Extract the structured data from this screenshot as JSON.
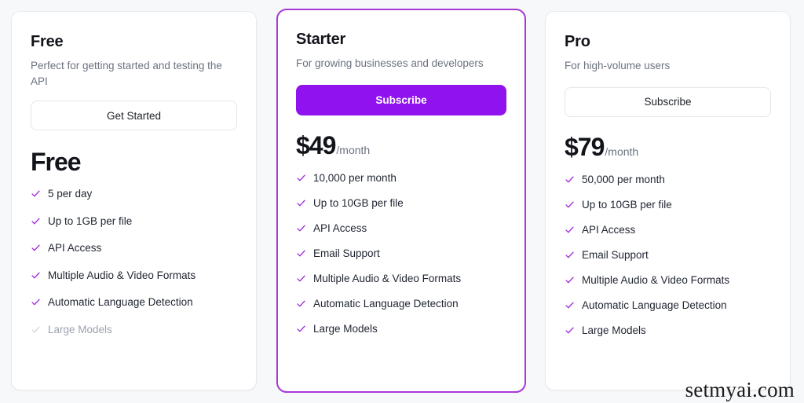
{
  "theme": {
    "page_background": "#f7f8fa",
    "accent": "#9013ef",
    "featured_border": "#a738d8",
    "check_color": "#a32fd8",
    "check_color_disabled": "#d2d6dc",
    "text_primary": "#12141a",
    "text_muted": "#6b7280"
  },
  "watermark": "setmyai.com",
  "plans": [
    {
      "id": "free",
      "name": "Free",
      "description": "Perfect for getting started and testing the API",
      "cta_label": "Get Started",
      "cta_style": "outline",
      "price_amount": "Free",
      "price_period": "",
      "featured": false,
      "features": [
        {
          "label": "5 per day",
          "enabled": true
        },
        {
          "label": "Up to 1GB per file",
          "enabled": true
        },
        {
          "label": "API Access",
          "enabled": true
        },
        {
          "label": "Multiple Audio & Video Formats",
          "enabled": true
        },
        {
          "label": "Automatic Language Detection",
          "enabled": true
        },
        {
          "label": "Large Models",
          "enabled": false
        }
      ]
    },
    {
      "id": "starter",
      "name": "Starter",
      "description": "For growing businesses and developers",
      "cta_label": "Subscribe",
      "cta_style": "filled",
      "price_amount": "$49",
      "price_period": "/month",
      "featured": true,
      "features": [
        {
          "label": "10,000 per month",
          "enabled": true
        },
        {
          "label": "Up to 10GB per file",
          "enabled": true
        },
        {
          "label": "API Access",
          "enabled": true
        },
        {
          "label": "Email Support",
          "enabled": true
        },
        {
          "label": "Multiple Audio & Video Formats",
          "enabled": true
        },
        {
          "label": "Automatic Language Detection",
          "enabled": true
        },
        {
          "label": "Large Models",
          "enabled": true
        }
      ]
    },
    {
      "id": "pro",
      "name": "Pro",
      "description": "For high-volume users",
      "cta_label": "Subscribe",
      "cta_style": "outline",
      "price_amount": "$79",
      "price_period": "/month",
      "featured": false,
      "features": [
        {
          "label": "50,000 per month",
          "enabled": true
        },
        {
          "label": "Up to 10GB per file",
          "enabled": true
        },
        {
          "label": "API Access",
          "enabled": true
        },
        {
          "label": "Email Support",
          "enabled": true
        },
        {
          "label": "Multiple Audio & Video Formats",
          "enabled": true
        },
        {
          "label": "Automatic Language Detection",
          "enabled": true
        },
        {
          "label": "Large Models",
          "enabled": true
        }
      ]
    }
  ]
}
